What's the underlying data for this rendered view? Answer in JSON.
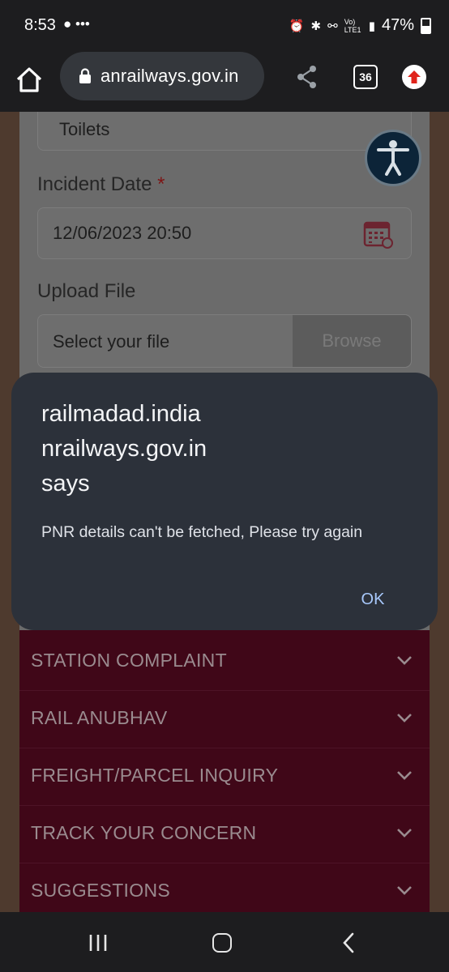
{
  "status_bar": {
    "time": "8:53",
    "left_icons": "● •••",
    "battery_percent": "47%",
    "network": "Vo) LTE1"
  },
  "browser": {
    "url": "anrailways.gov.in",
    "tab_count": "36"
  },
  "form": {
    "category_value": "Toilets",
    "incident_date_label": "Incident Date",
    "required_mark": "*",
    "incident_date_value": "12/06/2023 20:50",
    "upload_label": "Upload File",
    "upload_placeholder": "Select your file",
    "browse_label": "Browse"
  },
  "menu": {
    "items": [
      {
        "label": "STATION COMPLAINT"
      },
      {
        "label": "RAIL ANUBHAV"
      },
      {
        "label": "FREIGHT/PARCEL INQUIRY"
      },
      {
        "label": "TRACK YOUR CONCERN"
      },
      {
        "label": "SUGGESTIONS"
      }
    ]
  },
  "dialog": {
    "title_line1": "railmadad.india",
    "title_line2": "nrailways.gov.in",
    "title_line3": "says",
    "message": "PNR details can't be fetched, Please try again",
    "ok_label": "OK"
  },
  "colors": {
    "menu_bg": "#400718",
    "dialog_bg": "#2c313a",
    "ok_accent": "#a8c8fb",
    "update_badge": "#e0241b"
  }
}
